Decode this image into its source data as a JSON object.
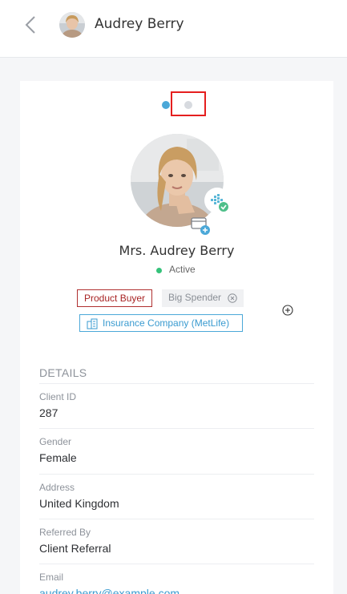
{
  "header": {
    "title": "Audrey Berry",
    "back_icon": "chevron-left-icon"
  },
  "carousel": {
    "pages": 2,
    "active_index": 0,
    "active_color": "#4ba8d8",
    "inactive_color": "#d7dadf"
  },
  "profile": {
    "full_name": "Mrs. Audrey Berry",
    "status": "Active",
    "status_color": "#35c27a",
    "badge_icon": "verified-badge-icon",
    "add_card_icon": "add-card-icon"
  },
  "tags": {
    "product_buyer": "Product Buyer",
    "big_spender": "Big Spender",
    "insurance": "Insurance Company (MetLife)"
  },
  "details": {
    "heading": "DETAILS",
    "fields": [
      {
        "label": "Client ID",
        "value": "287"
      },
      {
        "label": "Gender",
        "value": "Female"
      },
      {
        "label": "Address",
        "value": "United Kingdom"
      },
      {
        "label": "Referred By",
        "value": "Client Referral"
      },
      {
        "label": "Email",
        "value": "audrey.berry@example.com"
      }
    ]
  }
}
